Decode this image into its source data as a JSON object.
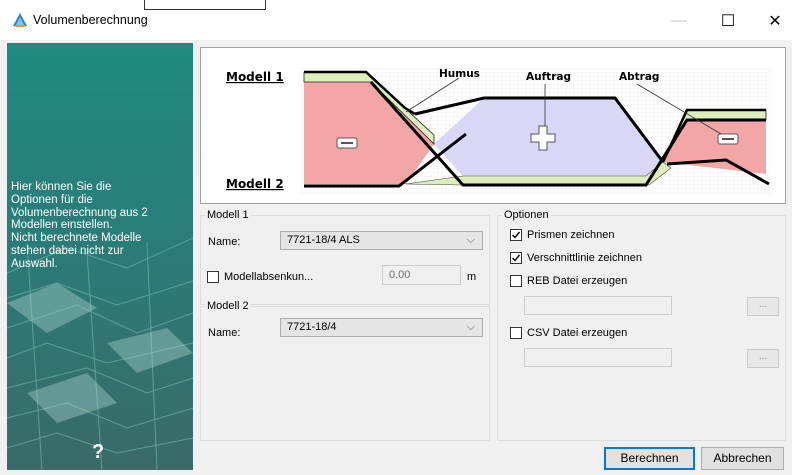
{
  "window": {
    "title": "Volumenberechnung",
    "icon": "app-triangle-icon",
    "controls": {
      "minimize": "—",
      "maximize": "☐",
      "close": "✕"
    }
  },
  "side_panel": {
    "info_lines": [
      "Hier können Sie die",
      "Optionen für die",
      "Volumenberechnung aus 2",
      "Modellen einstellen.",
      "Nicht berechnete Modelle",
      "stehen dabei nicht zur",
      "Auswahl."
    ],
    "help": "?",
    "background_color": "#2a7a74"
  },
  "diagram": {
    "model1": "Modell 1",
    "model2": "Modell 2",
    "humus": "Humus",
    "auftrag": "Auftrag",
    "abtrag": "Abtrag",
    "colors": {
      "abtrag": "#f2a6a6",
      "auftrag": "#d8d8f6",
      "humus": "#dceebc"
    }
  },
  "modell1": {
    "legend": "Modell 1",
    "name_label": "Name:",
    "selected": "7721-18/4 ALS",
    "absenkung_label": "Modellabsenkun...",
    "absenkung_checked": false,
    "absenkung_value": "0.00",
    "unit": "m"
  },
  "modell2": {
    "legend": "Modell 2",
    "name_label": "Name:",
    "selected": "7721-18/4"
  },
  "optionen": {
    "legend": "Optionen",
    "prismen": {
      "label": "Prismen zeichnen",
      "checked": true
    },
    "verschnitt": {
      "label": "Verschnittlinie zeichnen",
      "checked": true
    },
    "reb": {
      "label": "REB Datei erzeugen",
      "checked": false,
      "path": "",
      "browse": "..."
    },
    "csv": {
      "label": "CSV Datei erzeugen",
      "checked": false,
      "path": "",
      "browse": "..."
    }
  },
  "buttons": {
    "berechnen": "Berechnen",
    "abbrechen": "Abbrechen"
  }
}
